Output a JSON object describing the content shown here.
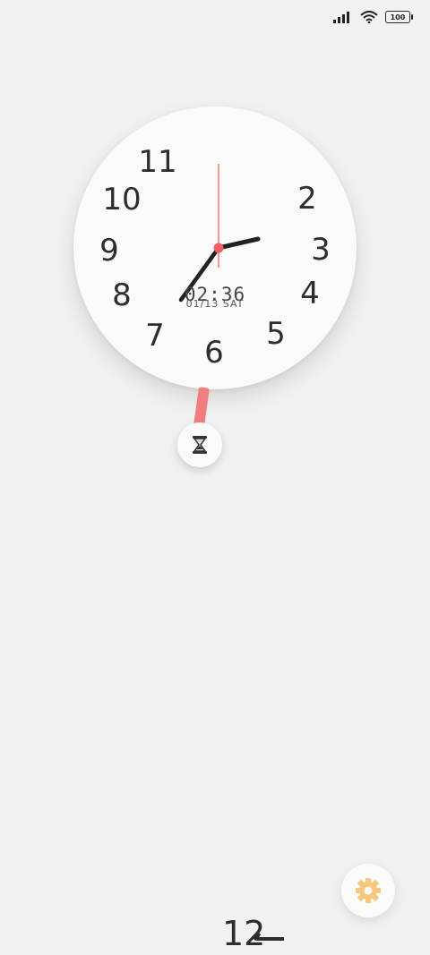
{
  "status_bar": {
    "signal_icon": "signal-bars-icon",
    "wifi_icon": "wifi-icon",
    "battery_level": "100"
  },
  "clock": {
    "numerals": [
      "2",
      "3",
      "4",
      "5",
      "6",
      "7",
      "8",
      "9",
      "10",
      "11"
    ],
    "digital_time": "02:36",
    "date": "01/13 SAT",
    "hour_hand_time": "02:36",
    "colors": {
      "face": "#fafafa",
      "hands": "#222222",
      "second_hand": "#f06060"
    }
  },
  "timer": {
    "icon": "hourglass-icon",
    "pendulum_color": "#f17e7e"
  },
  "settings": {
    "icon": "gear-icon",
    "color": "#f6c77a"
  },
  "bottom": {
    "counter_text": "12"
  }
}
